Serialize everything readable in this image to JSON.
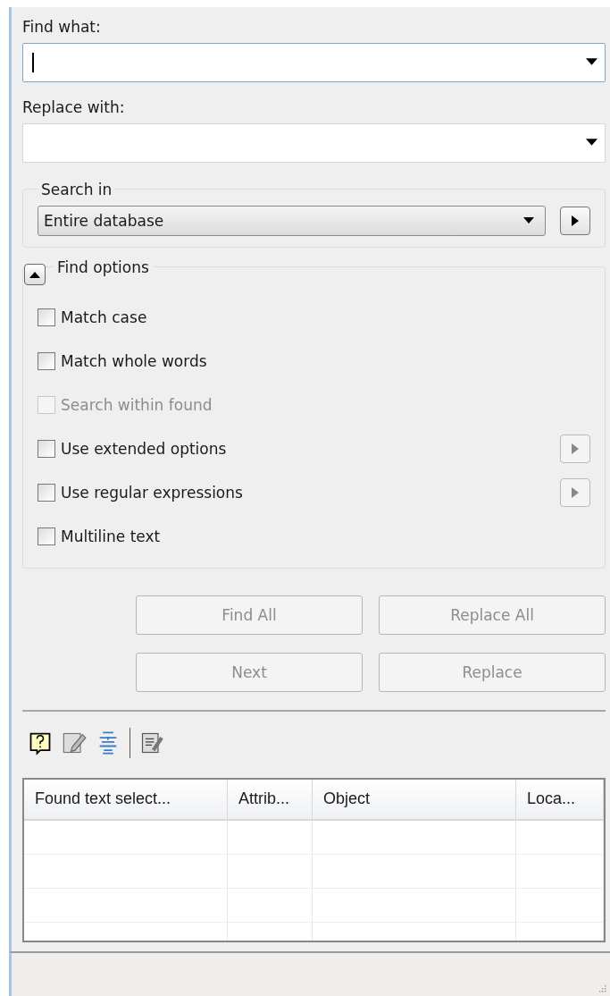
{
  "find_what": {
    "label": "Find what:"
  },
  "replace_with": {
    "label": "Replace with:"
  },
  "search_in": {
    "legend": "Search in",
    "value": "Entire database",
    "more_disabled": false
  },
  "find_options": {
    "legend": "Find options",
    "expanded": true,
    "options": [
      {
        "label": "Match case",
        "checked": false,
        "disabled": false,
        "has_more": false
      },
      {
        "label": "Match whole words",
        "checked": false,
        "disabled": false,
        "has_more": false
      },
      {
        "label": "Search within found",
        "checked": false,
        "disabled": true,
        "has_more": false
      },
      {
        "label": "Use extended options",
        "checked": false,
        "disabled": false,
        "has_more": true
      },
      {
        "label": "Use regular expressions",
        "checked": false,
        "disabled": false,
        "has_more": true
      },
      {
        "label": "Multiline text",
        "checked": false,
        "disabled": false,
        "has_more": false
      }
    ]
  },
  "buttons": [
    {
      "label": "Find All",
      "disabled": true
    },
    {
      "label": "Replace All",
      "disabled": true
    },
    {
      "label": "Next",
      "disabled": true
    },
    {
      "label": "Replace",
      "disabled": true
    }
  ],
  "results": {
    "columns": [
      "Found text select...",
      "Attrib...",
      "Object",
      "Loca..."
    ]
  }
}
